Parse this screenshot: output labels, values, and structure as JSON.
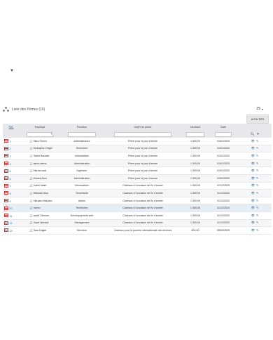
{
  "page": {
    "title": "Liste des Primes (16)",
    "per_page": "25",
    "add_label": "AJOUTER"
  },
  "columns": {
    "ref": "Ref.",
    "employe": "Employé",
    "fonction": "Fonction",
    "objet": "Objet de prime",
    "montant": "Montant",
    "date": "Date"
  },
  "rows": [
    {
      "id": "1",
      "employe": "Marc Simon",
      "fonction": "Administrateur",
      "objet": "Prime pour le jour d'année",
      "montant": "1 500,00",
      "date": "01/01/2020"
    },
    {
      "id": "2",
      "employe": "Mustapha Chtger",
      "fonction": "Technicien",
      "objet": "Prime pour le jour d'année",
      "montant": "1 500,00",
      "date": "01/01/2020"
    },
    {
      "id": "3",
      "employe": "Samir Bandarr",
      "fonction": "Informaticien",
      "objet": "Prime pour le jour d'année",
      "montant": "1 500,00",
      "date": "01/01/2020"
    },
    {
      "id": "4",
      "employe": "demo demo",
      "fonction": "Administration",
      "objet": "Prime pour le jour d'année",
      "montant": "1 500,00",
      "date": "01/01/2020"
    },
    {
      "id": "5",
      "employe": "Mouna sadi",
      "fonction": "Ingénieur",
      "objet": "Prime pour le jour d'année",
      "montant": "1 500,00",
      "date": "01/01/2020"
    },
    {
      "id": "6",
      "employe": "Ahmed Alou",
      "fonction": "Administration",
      "objet": "Prime pour le jour d'année",
      "montant": "1 500,00",
      "date": "01/01/2020"
    },
    {
      "id": "7",
      "employe": "Karim Nasri",
      "fonction": "Informaticien",
      "objet": "Cadeaux à l'occasion de fin d'année",
      "montant": "1 500,00",
      "date": "31/12/2020"
    },
    {
      "id": "8",
      "employe": "Ibtissam Alou",
      "fonction": "Secrétariat",
      "objet": "Cadeaux à l'occasion de fin d'année",
      "montant": "1 500,00",
      "date": "31/12/2020"
    },
    {
      "id": "9",
      "employe": "Maryam Maryam",
      "fonction": "Admin",
      "objet": "Cadeaux à l'occasion de fin d'année",
      "montant": "1 500,00",
      "date": "31/12/2020"
    },
    {
      "id": "10",
      "employe": "momo",
      "fonction": "Technicien",
      "objet": "Cadeaux à l'occasion de fin d'année",
      "montant": "1 500,00",
      "date": "31/12/2020"
    },
    {
      "id": "11",
      "employe": "saadi Othman",
      "fonction": "Développement web",
      "objet": "Cadeaux à l'occasion de fin d'année",
      "montant": "1 500,00",
      "date": "31/12/2020"
    },
    {
      "id": "12",
      "employe": "Saad Hamadi",
      "fonction": "Management",
      "objet": "Cadeaux à l'occasion de fin d'année",
      "montant": "1 500,00",
      "date": "31/12/2020"
    },
    {
      "id": "13",
      "employe": "Sara Najjari",
      "fonction": "Direction",
      "objet": "Cadeaux pour la journée internationale des femmes",
      "montant": "500,00",
      "date": "08/03/2020"
    }
  ],
  "icons": {
    "row": "payslip-icon",
    "user": "user-icon",
    "view": "eye-icon",
    "edit": "edit-icon",
    "search": "search-icon",
    "clear": "clear-filter-icon",
    "caret": "caret-down-icon"
  },
  "colors": {
    "header_bg": "#e7e8ec",
    "link": "#2a6496",
    "row_icon": "#cc3333",
    "highlight_row": "#e7edf5"
  }
}
